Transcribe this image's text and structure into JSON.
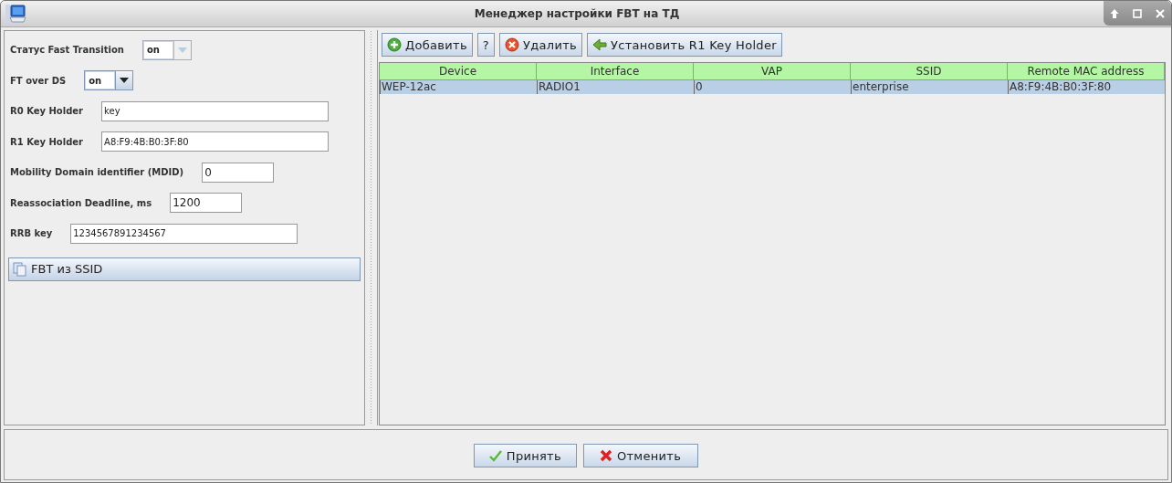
{
  "window": {
    "title": "Менеджер настройки FBT на ТД"
  },
  "settings": [
    {
      "kind": "combo",
      "label": "Статус Fast Transition",
      "value": "on",
      "disabled": true
    },
    {
      "kind": "combo",
      "label": "FT over DS",
      "value": "on",
      "disabled": false
    },
    {
      "kind": "text",
      "label": "R0 Key Holder",
      "value": "key"
    },
    {
      "kind": "text",
      "label": "R1 Key Holder",
      "value": "A8:F9:4B:B0:3F:80"
    },
    {
      "kind": "number",
      "label": "Mobility Domain identifier (MDID)",
      "value": "0"
    },
    {
      "kind": "number",
      "label": "Reassociation Deadline, ms",
      "value": "1200"
    },
    {
      "kind": "text",
      "label": "RRB key",
      "value": "1234567891234567"
    }
  ],
  "fbt_button": "FBT из SSID",
  "toolbar": [
    {
      "kind": "add",
      "label": "Добавить"
    },
    {
      "kind": "help",
      "label": "?"
    },
    {
      "kind": "delete",
      "label": "Удалить"
    },
    {
      "kind": "set",
      "label": "Установить R1 Key Holder"
    }
  ],
  "table": {
    "columns": [
      "Device",
      "Interface",
      "VAP",
      "SSID",
      "Remote MAC address"
    ],
    "rows": [
      {
        "cells": [
          "WEP-12ac",
          "RADIO1",
          "0",
          "enterprise",
          "A8:F9:4B:B0:3F:80"
        ],
        "selected": true
      }
    ]
  },
  "buttons": [
    {
      "kind": "accept",
      "label": "Принять"
    },
    {
      "kind": "cancel",
      "label": "Отменить"
    }
  ]
}
